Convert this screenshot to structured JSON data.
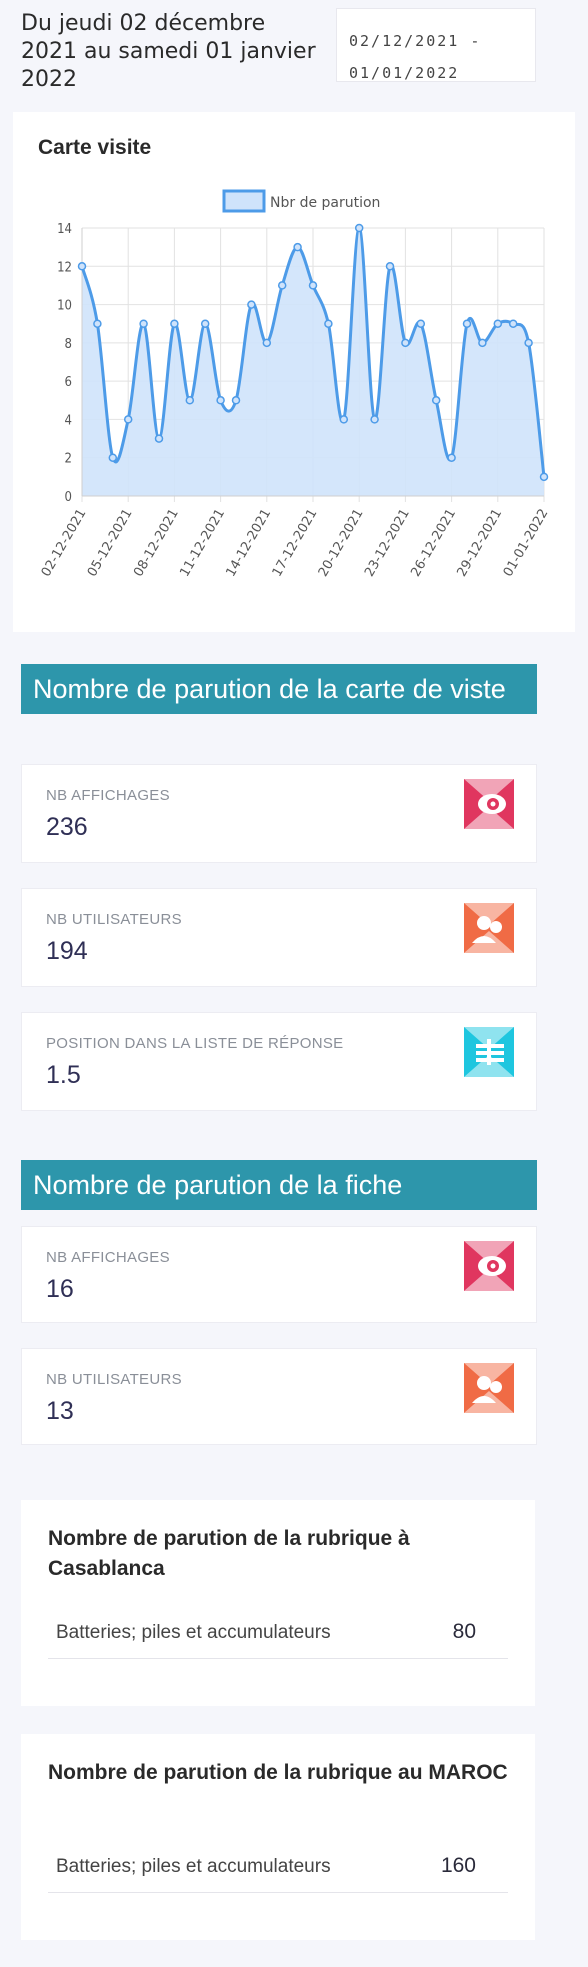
{
  "header": {
    "date_range_text": "Du jeudi 02 décembre 2021 au samedi 01 janvier 2022",
    "date_input_value": "02/12/2021 - 01/01/2022"
  },
  "chart_card": {
    "title": "Carte visite"
  },
  "chart_data": {
    "type": "line",
    "fill": true,
    "title": "",
    "xlabel": "",
    "ylabel": "",
    "x": [
      "02-12-2021",
      "03-12-2021",
      "04-12-2021",
      "05-12-2021",
      "06-12-2021",
      "07-12-2021",
      "08-12-2021",
      "09-12-2021",
      "10-12-2021",
      "11-12-2021",
      "12-12-2021",
      "13-12-2021",
      "14-12-2021",
      "15-12-2021",
      "16-12-2021",
      "17-12-2021",
      "18-12-2021",
      "19-12-2021",
      "20-12-2021",
      "21-12-2021",
      "22-12-2021",
      "23-12-2021",
      "24-12-2021",
      "25-12-2021",
      "26-12-2021",
      "27-12-2021",
      "28-12-2021",
      "29-12-2021",
      "30-12-2021",
      "31-12-2021",
      "01-01-2022"
    ],
    "tick_labels": [
      "02-12-2021",
      "05-12-2021",
      "08-12-2021",
      "11-12-2021",
      "14-12-2021",
      "17-12-2021",
      "20-12-2021",
      "23-12-2021",
      "26-12-2021",
      "29-12-2021",
      "01-01-2022"
    ],
    "series": [
      {
        "name": "Nbr de parution",
        "values": [
          12,
          9,
          2,
          4,
          9,
          3,
          9,
          5,
          9,
          5,
          5,
          10,
          8,
          11,
          13,
          11,
          9,
          4,
          14,
          4,
          12,
          8,
          9,
          5,
          2,
          9,
          8,
          9,
          9,
          8,
          1
        ]
      }
    ],
    "ylim": [
      0,
      14
    ],
    "yticks": [
      0,
      2,
      4,
      6,
      8,
      10,
      12,
      14
    ],
    "grid": true,
    "legend_position": "top",
    "colors": {
      "line": "#4d9be8",
      "fill": "#cfe3fb"
    }
  },
  "section_carte": {
    "title": "Nombre de parution de la carte de viste",
    "stats": [
      {
        "label": "NB AFFICHAGES",
        "value": "236",
        "icon": "eye-icon",
        "color": "#e0365f"
      },
      {
        "label": "NB UTILISATEURS",
        "value": "194",
        "icon": "users-icon",
        "color": "#f06b45"
      },
      {
        "label": "POSITION DANS LA LISTE DE RÉPONSE",
        "value": "1.5",
        "icon": "list-position-icon",
        "color": "#1ec6df"
      }
    ]
  },
  "section_fiche": {
    "title": "Nombre de parution de la fiche",
    "stats": [
      {
        "label": "NB AFFICHAGES",
        "value": "16",
        "icon": "eye-icon",
        "color": "#e0365f"
      },
      {
        "label": "NB UTILISATEURS",
        "value": "13",
        "icon": "users-icon",
        "color": "#f06b45"
      }
    ]
  },
  "rubrique_casablanca": {
    "title": "Nombre de parution de la rubrique à Casablanca",
    "rows": [
      {
        "name": "Batteries; piles et accumulateurs",
        "value": "80"
      }
    ]
  },
  "rubrique_maroc": {
    "title": "Nombre de parution de la rubrique au MAROC",
    "rows": [
      {
        "name": "Batteries; piles et accumulateurs",
        "value": "160"
      }
    ]
  }
}
